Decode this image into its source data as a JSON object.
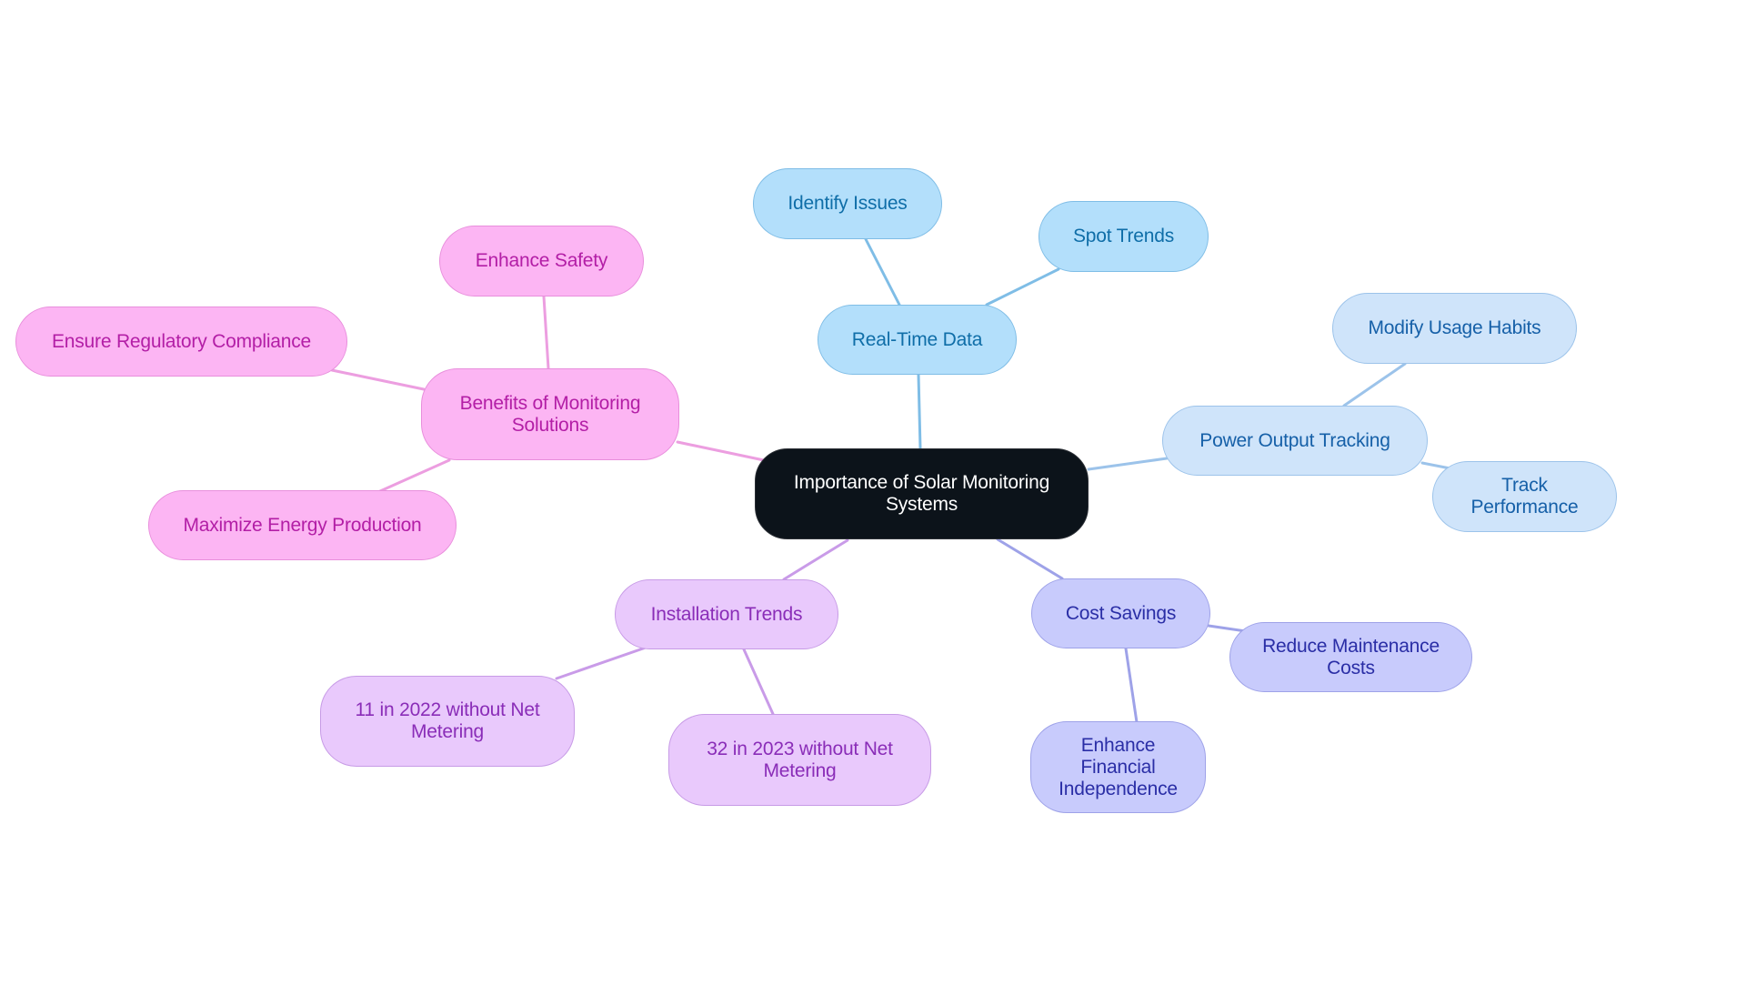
{
  "diagram": {
    "type": "mindmap",
    "root": {
      "id": "root",
      "label": "Importance of Solar Monitoring Systems"
    },
    "branches": [
      {
        "id": "benefits",
        "label": "Benefits of Monitoring Solutions",
        "theme": "pink",
        "children": [
          {
            "id": "safety",
            "label": "Enhance Safety"
          },
          {
            "id": "compliance",
            "label": "Ensure Regulatory Compliance"
          },
          {
            "id": "energy",
            "label": "Maximize Energy Production"
          }
        ]
      },
      {
        "id": "realtime",
        "label": "Real-Time Data",
        "theme": "blue",
        "children": [
          {
            "id": "issues",
            "label": "Identify Issues"
          },
          {
            "id": "trends",
            "label": "Spot Trends"
          }
        ]
      },
      {
        "id": "power",
        "label": "Power Output Tracking",
        "theme": "light-blue",
        "children": [
          {
            "id": "habits",
            "label": "Modify Usage Habits"
          },
          {
            "id": "performance",
            "label": "Track Performance"
          }
        ]
      },
      {
        "id": "cost",
        "label": "Cost Savings",
        "theme": "indigo",
        "children": [
          {
            "id": "maintenance",
            "label": "Reduce Maintenance Costs"
          },
          {
            "id": "financial",
            "label": "Enhance Financial Independence"
          }
        ]
      },
      {
        "id": "install",
        "label": "Installation Trends",
        "theme": "purple",
        "children": [
          {
            "id": "y2022",
            "label": "11 in 2022 without Net Metering"
          },
          {
            "id": "y2023",
            "label": "32 in 2023 without Net Metering"
          }
        ]
      }
    ],
    "colors": {
      "root_fill": "#0c131a",
      "pink_edge": "#ec9ee0",
      "blue_edge": "#7fbde6",
      "light_blue_edge": "#9cc3ea",
      "indigo_edge": "#9ea2e8",
      "purple_edge": "#c99be8"
    }
  }
}
